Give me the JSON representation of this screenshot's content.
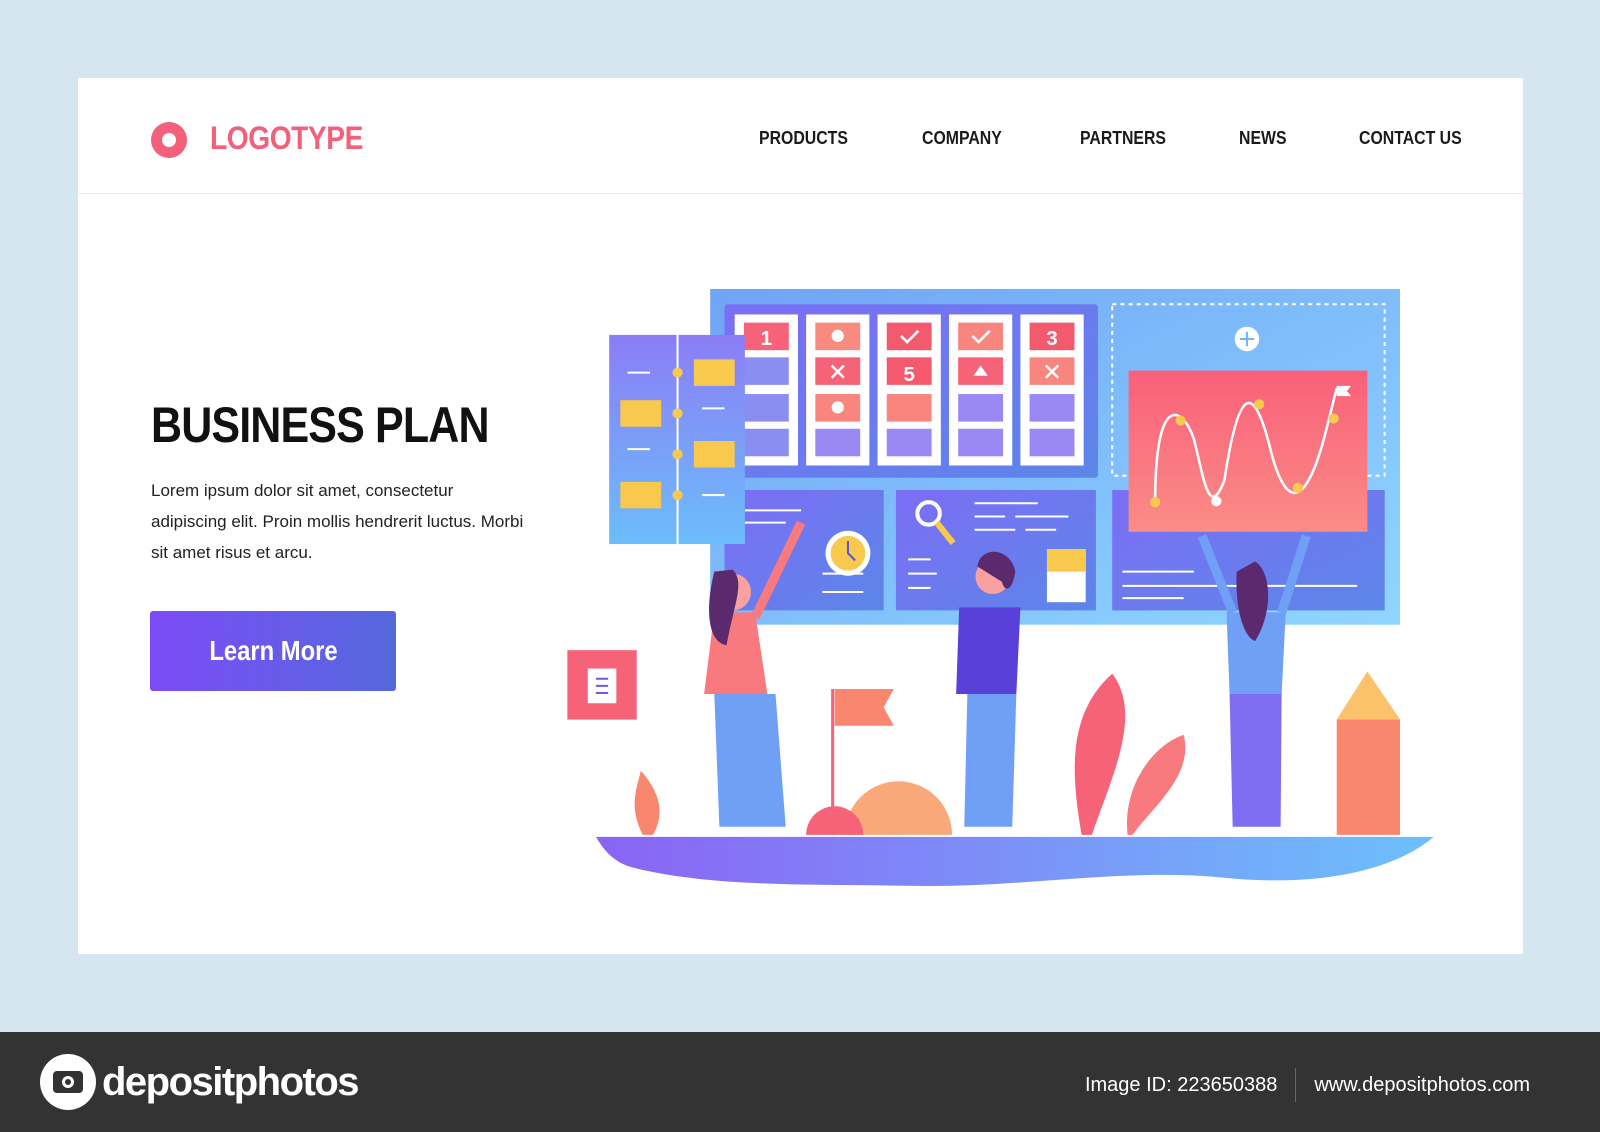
{
  "header": {
    "logo": "LOGOTYPE",
    "nav": [
      "PRODUCTS",
      "COMPANY",
      "PARTNERS",
      "NEWS",
      "CONTACT US"
    ]
  },
  "hero": {
    "title": "BUSINESS PLAN",
    "body": "Lorem ipsum dolor sit amet, consectetur adipiscing elit. Proin mollis hendrerit luctus. Morbi sit amet risus et arcu.",
    "button": "Learn More"
  },
  "illustration": {
    "card_numbers": [
      "1",
      "5",
      "3"
    ]
  },
  "footer": {
    "brand": "depositphotos",
    "image_id": "Image ID: 223650388",
    "site": "www.depositphotos.com"
  },
  "colors": {
    "accent": "#f2607a",
    "button_start": "#7d4cf7",
    "button_end": "#5468dc",
    "background": "#d6e6f1",
    "footer": "#333333"
  }
}
